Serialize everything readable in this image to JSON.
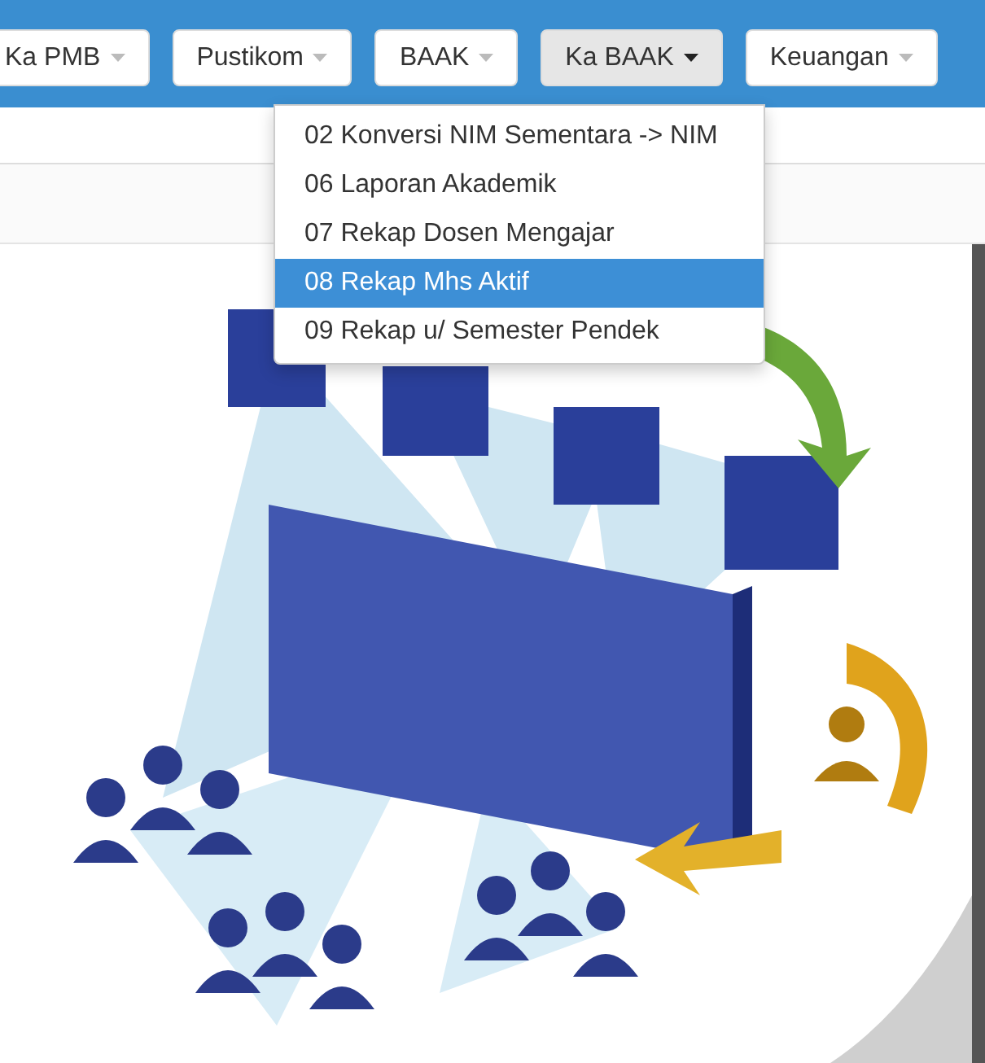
{
  "nav": {
    "buttons": [
      {
        "label": "Ka PMB",
        "selected": false
      },
      {
        "label": "Pustikom",
        "selected": false
      },
      {
        "label": "BAAK",
        "selected": false
      },
      {
        "label": "Ka BAAK",
        "selected": true
      },
      {
        "label": "Keuangan",
        "selected": false
      }
    ]
  },
  "dropdown": {
    "items": [
      {
        "label": "02 Konversi NIM Sementara -> NIM",
        "selected": false
      },
      {
        "label": "06 Laporan Akademik",
        "selected": false
      },
      {
        "label": "07 Rekap Dosen Mengajar",
        "selected": false
      },
      {
        "label": "08 Rekap Mhs Aktif",
        "selected": true
      },
      {
        "label": "09 Rekap u/ Semester Pendek",
        "selected": false
      }
    ]
  }
}
